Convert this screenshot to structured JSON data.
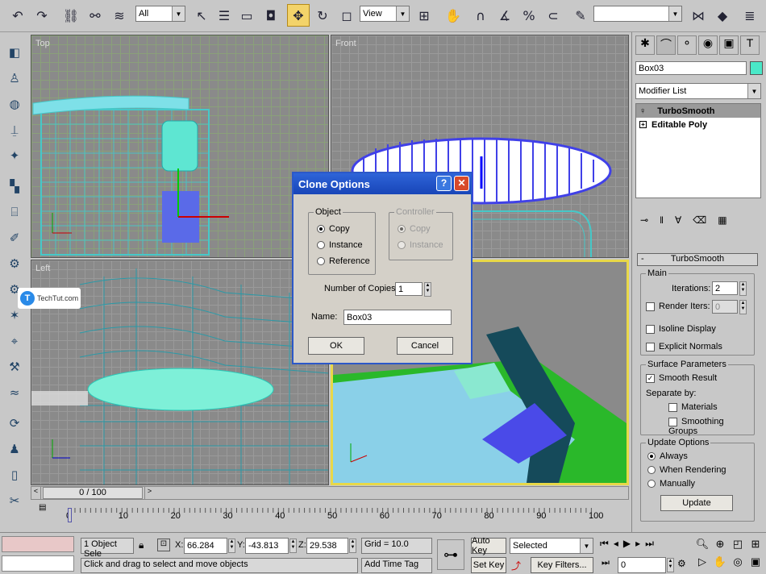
{
  "toolbar": {
    "filter_value": "All",
    "coord_system": "View",
    "selection_set": ""
  },
  "viewports": {
    "top": "Top",
    "front": "Front",
    "left": "Left",
    "perspective": ""
  },
  "watermark": "TechTut.com",
  "time_slider": {
    "label": "0 / 100",
    "ticks": [
      "0",
      "10",
      "20",
      "30",
      "40",
      "50",
      "60",
      "70",
      "80",
      "90",
      "100"
    ]
  },
  "dialog": {
    "title": "Clone Options",
    "object_group": "Object",
    "controller_group": "Controller",
    "copy": "Copy",
    "instance": "Instance",
    "reference": "Reference",
    "ctrl_copy": "Copy",
    "ctrl_instance": "Instance",
    "copies_label": "Number of Copies:",
    "copies_value": "1",
    "name_label": "Name:",
    "name_value": "Box03",
    "ok": "OK",
    "cancel": "Cancel"
  },
  "command_panel": {
    "object_name": "Box03",
    "modifier_list": "Modifier List",
    "stack": [
      "TurboSmooth",
      "Editable Poly"
    ],
    "rollout_title": "TurboSmooth",
    "main_group": "Main",
    "iterations_label": "Iterations:",
    "iterations_value": "2",
    "render_iters_label": "Render Iters:",
    "render_iters_value": "0",
    "isoline": "Isoline Display",
    "explicit_normals": "Explicit Normals",
    "surface_group": "Surface Parameters",
    "smooth_result": "Smooth Result",
    "separate_by": "Separate by:",
    "materials": "Materials",
    "smoothing_groups": "Smoothing Groups",
    "update_group": "Update Options",
    "always": "Always",
    "when_rendering": "When Rendering",
    "manually": "Manually",
    "update_button": "Update"
  },
  "status": {
    "selection": "1 Object Sele",
    "x_label": "X:",
    "x_value": "66.284",
    "y_label": "Y:",
    "y_value": "-43.813",
    "z_label": "Z:",
    "z_value": "29.538",
    "grid": "Grid = 10.0",
    "prompt": "Click and drag to select and move objects",
    "add_time_tag": "Add Time Tag",
    "auto_key": "Auto Key",
    "set_key": "Set Key",
    "key_mode": "Selected",
    "key_filters": "Key Filters...",
    "frame": "0"
  }
}
